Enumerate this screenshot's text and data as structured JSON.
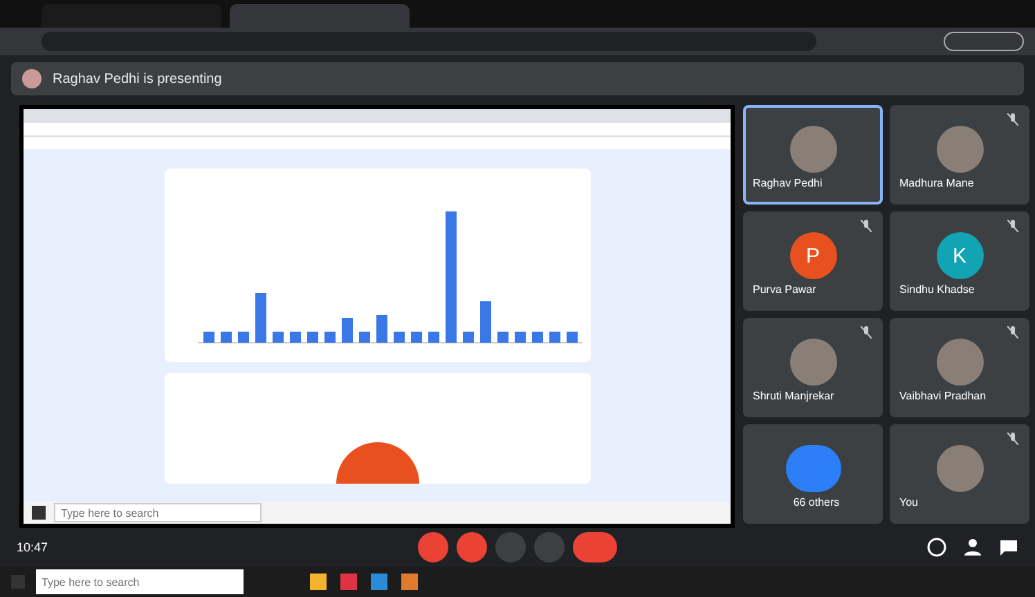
{
  "banner": {
    "text": "Raghav Pedhi is presenting"
  },
  "shared_screen": {
    "taskbar": {
      "search": {
        "placeholder": "Type here to search"
      }
    }
  },
  "tiles": [
    {
      "name": "Raghav Pedhi",
      "kind": "photo",
      "selected": true,
      "muted": false
    },
    {
      "name": "Madhura Mane",
      "kind": "photo",
      "selected": false,
      "muted": true
    },
    {
      "name": "Purva Pawar",
      "kind": "letter",
      "letter": "P",
      "color": "#e8511f",
      "selected": false,
      "muted": true
    },
    {
      "name": "Sindhu Khadse",
      "kind": "letter",
      "letter": "K",
      "color": "#12a4b3",
      "selected": false,
      "muted": true
    },
    {
      "name": "Shruti Manjrekar",
      "kind": "photo",
      "selected": false,
      "muted": true
    },
    {
      "name": "Vaibhavi Pradhan",
      "kind": "photo",
      "selected": false,
      "muted": true
    },
    {
      "name": "66 others",
      "kind": "group",
      "selected": false,
      "muted": false
    },
    {
      "name": "You",
      "kind": "photo",
      "selected": false,
      "muted": true
    }
  ],
  "meeting_bar": {
    "time": "10:47",
    "controls": [
      {
        "kind": "mic",
        "on": false
      },
      {
        "kind": "camera",
        "on": false
      },
      {
        "kind": "present",
        "on": true
      },
      {
        "kind": "more",
        "on": true
      },
      {
        "kind": "hangup"
      }
    ]
  },
  "taskbar": {
    "search": {
      "placeholder": "Type here to search"
    }
  }
}
